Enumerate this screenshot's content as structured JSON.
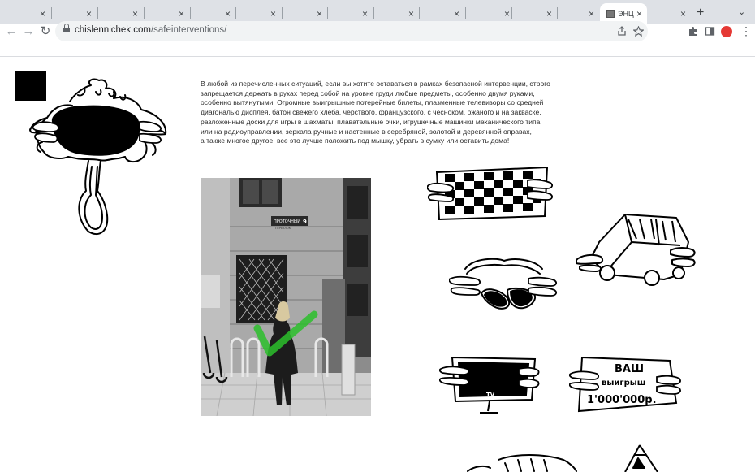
{
  "browser": {
    "tabs_close_glyph": "×",
    "active_tab_title": "ЭНЦ",
    "new_tab_glyph": "+",
    "tab_menu_glyph": "⌄",
    "nav": {
      "back": "←",
      "forward": "→",
      "reload": "↻"
    },
    "url_host": "chislennichek.com",
    "url_path": "/safeinterventions/",
    "icons": [
      "share-icon",
      "star-icon",
      "puzzle-extensions-icon",
      "side-panel-icon",
      "profile-avatar",
      "more-menu-icon"
    ],
    "menu_glyph": "⋮",
    "profile_color": "#e53935"
  },
  "article": {
    "lines": [
      "В любой из перечисленных ситуаций, если вы хотите оставаться в рамках безопасной интервенции, строго",
      "запрещается держать в руках перед собой на уровне груди любые предметы, особенно двумя руками,",
      "особенно вытянутыми. Огромные выигрышные потерейные билеты, плазменные телевизоры со средней",
      "диагональю дисплея, батон свежего хлеба, черствого, французского, с чесноком, ржаного и на закваске,",
      "разложенные доски для игры в шахматы, плавательные очки, игрушечные машинки механического типа",
      "или на радиоуправлении, зеркала ручные и настенные в серебряной, золотой и деревянной оправах,",
      "а также многое другое, все это лучше положить под мышку, убрать в сумку или оставить дома!"
    ]
  },
  "photo": {
    "street_sign": "ПРОТОЧНЫЙ",
    "street_sign_sub": "ПЕРЕУЛОК",
    "house_number": "9",
    "checkmark_color": "#2bbf2b"
  },
  "doodles": {
    "ticket_line1": "ВАШ",
    "ticket_line2": "выигрыш",
    "ticket_line3": "1'000'000р.",
    "tv_label": "TV"
  }
}
